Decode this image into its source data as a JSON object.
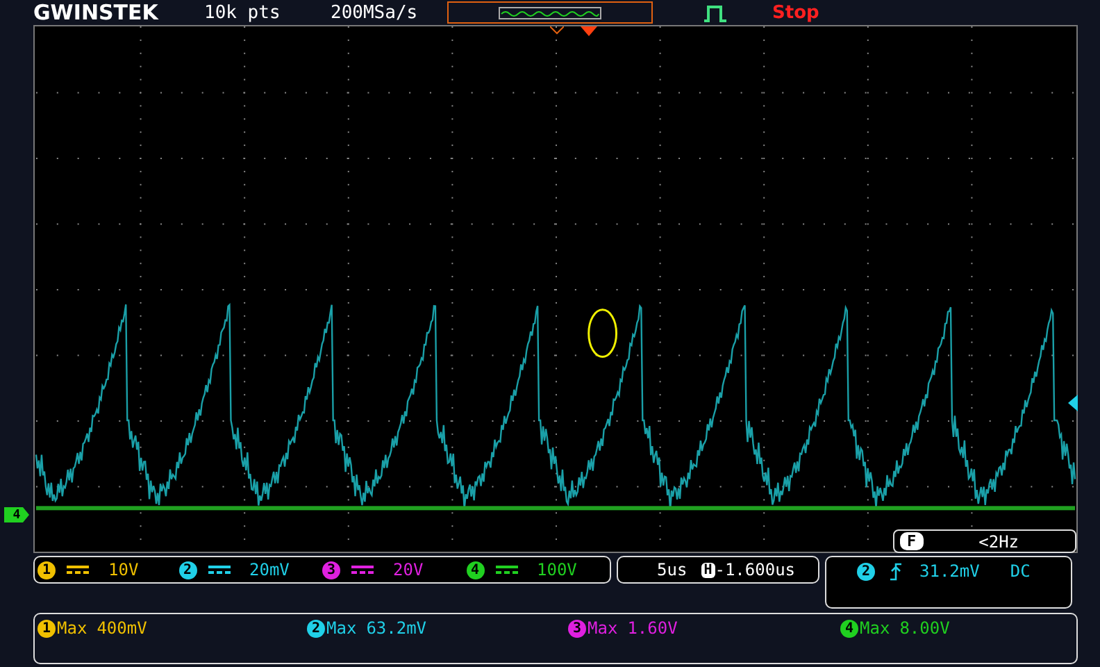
{
  "header": {
    "brand": "GWINSTEK",
    "record_length": "10k pts",
    "sample_rate": "200MSa/s",
    "run_state": "Stop"
  },
  "display": {
    "frequency_label": "F",
    "frequency": "<2Hz",
    "ground_marker": "4"
  },
  "channels": [
    {
      "number": "1",
      "scale": "10V",
      "color": "#f0c000"
    },
    {
      "number": "2",
      "scale": "20mV",
      "color": "#20d0e8"
    },
    {
      "number": "3",
      "scale": "20V",
      "color": "#e020e0"
    },
    {
      "number": "4",
      "scale": "100V",
      "color": "#20d020"
    }
  ],
  "timebase": {
    "scale": "5us",
    "position_label": "H",
    "position": "-1.600us"
  },
  "trigger": {
    "source": "2",
    "level": "31.2mV",
    "coupling": "DC"
  },
  "measurements": [
    {
      "channel": "1",
      "label": "Max",
      "value": "400mV",
      "color": "#f0c000"
    },
    {
      "channel": "2",
      "label": "Max",
      "value": "63.2mV",
      "color": "#20d0e8"
    },
    {
      "channel": "3",
      "label": "Max",
      "value": "1.60V",
      "color": "#e020e0"
    },
    {
      "channel": "4",
      "label": "Max",
      "value": "8.00V",
      "color": "#20d020"
    }
  ]
}
